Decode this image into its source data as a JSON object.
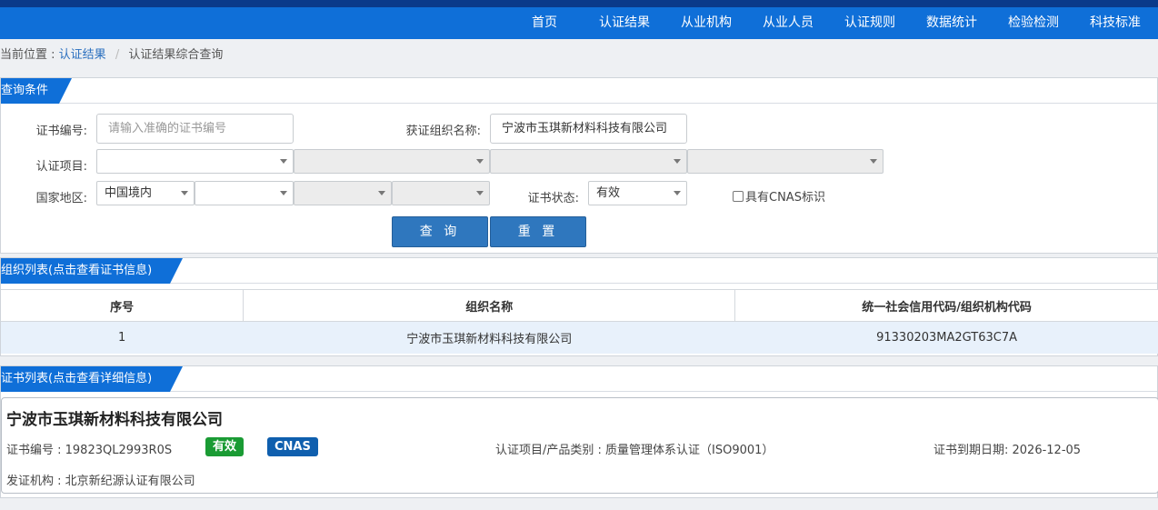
{
  "nav": {
    "items": [
      "首页",
      "认证结果",
      "从业机构",
      "从业人员",
      "认证规则",
      "数据统计",
      "检验检测",
      "科技标准"
    ]
  },
  "breadcrumb": {
    "prefix": "当前位置 :",
    "link": "认证结果",
    "current": "认证结果综合查询",
    "separator": "/"
  },
  "query": {
    "title": "查询条件",
    "cert_no_label": "证书编号:",
    "cert_no_placeholder": "请输入准确的证书编号",
    "org_label": "获证组织名称:",
    "org_value": "宁波市玉琪新材料科技有限公司",
    "project_label": "认证项目:",
    "region_label": "国家地区:",
    "region_value": "中国境内",
    "status_label": "证书状态:",
    "status_value": "有效",
    "cnas_label": "具有CNAS标识",
    "search_button": "查 询",
    "reset_button": "重 置"
  },
  "org_list": {
    "title": "组织列表(点击查看证书信息)",
    "columns": [
      "序号",
      "组织名称",
      "统一社会信用代码/组织机构代码"
    ],
    "rows": [
      {
        "index": "1",
        "name": "宁波市玉琪新材料科技有限公司",
        "code": "91330203MA2GT63C7A"
      }
    ]
  },
  "cert_list": {
    "title": "证书列表(点击查看详细信息)",
    "card": {
      "company": "宁波市玉琪新材料科技有限公司",
      "cert_no": "证书编号 : 19823QL2993R0S",
      "status_badge": "有效",
      "cnas_badge": "CNAS",
      "project": "认证项目/产品类别 : 质量管理体系认证（ISO9001）",
      "expiry": "证书到期日期: 2026-12-05",
      "issuer": "发证机构 : 北京新纪源认证有限公司"
    }
  },
  "colors": {
    "nav": "#0f6fd8",
    "nav_top": "#0a3a8a",
    "button": "#2f77be",
    "badge_valid": "#1a9b34",
    "badge_cnas": "#0f5fae"
  }
}
